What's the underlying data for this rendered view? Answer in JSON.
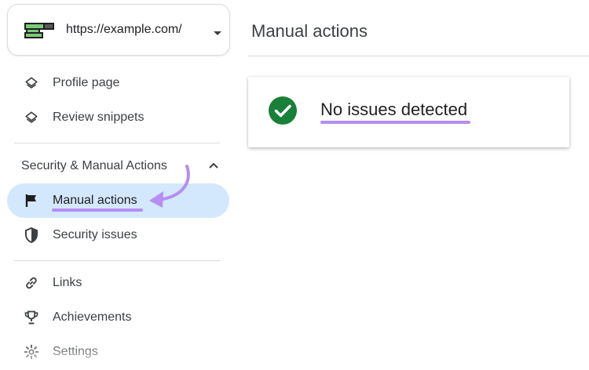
{
  "property": {
    "url": "https://example.com/"
  },
  "sidebar": {
    "items_top": [
      {
        "label": "Profile page",
        "icon": "layers-icon"
      },
      {
        "label": "Review snippets",
        "icon": "layers-icon"
      }
    ],
    "section_header": "Security & Manual Actions",
    "section_items": [
      {
        "label": "Manual actions",
        "icon": "flag-icon",
        "active": true
      },
      {
        "label": "Security issues",
        "icon": "shield-icon"
      }
    ],
    "items_bottom": [
      {
        "label": "Links",
        "icon": "link-icon"
      },
      {
        "label": "Achievements",
        "icon": "trophy-icon"
      },
      {
        "label": "Settings",
        "icon": "gear-icon"
      }
    ]
  },
  "main": {
    "title": "Manual actions",
    "status": {
      "text": "No issues detected",
      "icon": "check-circle-icon"
    }
  },
  "colors": {
    "active_bg": "#d3e8fd",
    "success": "#188038",
    "annotation": "#b68df2",
    "logo_green": "#7bc97b"
  }
}
